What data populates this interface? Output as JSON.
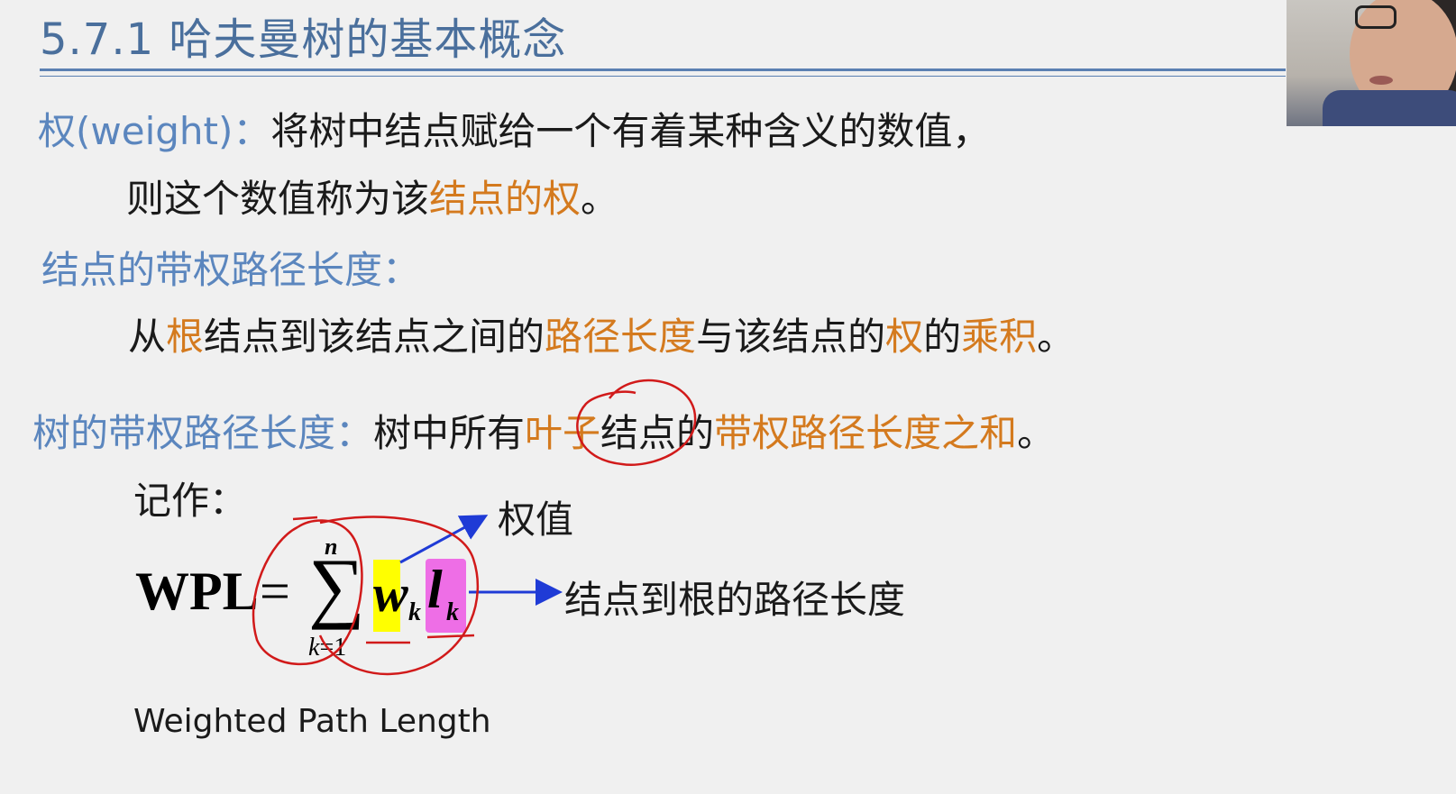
{
  "slide": {
    "title": "5.7.1 哈夫曼树的基本概念",
    "weight_def": {
      "term": "权(weight)",
      "colon": "：",
      "text1": "将树中结点赋给一个有着某种含义的数值，",
      "text2a": "则这个数值称为该",
      "text2b": "结点的权",
      "text2c": "。"
    },
    "node_wpl": {
      "term": "结点的带权路径长度：",
      "p1": "从",
      "p2": "根",
      "p3": "结点到该结点之间的",
      "p4": "路径长度",
      "p5": "与该结点的",
      "p6": "权",
      "p7": "的",
      "p8": "乘积",
      "p9": "。"
    },
    "tree_wpl": {
      "term": "树的带权路径长度：",
      "p1": "树中所有",
      "p2": "叶子",
      "p3": "结点的",
      "p4": "带权路径长度之和",
      "p5": "。"
    },
    "notation_label": "记作：",
    "formula": {
      "lhs": "WPL",
      "eq": "=",
      "sigma": "∑",
      "upper": "n",
      "lower_var": "k",
      "lower_rest": "=1",
      "w": "w",
      "w_sub": "k",
      "l": "l",
      "l_sub": "k"
    },
    "annotation_weight": "权值",
    "annotation_path": "结点到根的路径长度",
    "english_name": "Weighted Path Length"
  },
  "colors": {
    "heading_blue": "#5b86be",
    "emphasis_orange": "#d47a1e",
    "pen_red": "#d11a1a",
    "arrow_blue": "#1f3bd6",
    "highlight_yellow": "#ffff00",
    "highlight_magenta": "#ee6ee6"
  }
}
